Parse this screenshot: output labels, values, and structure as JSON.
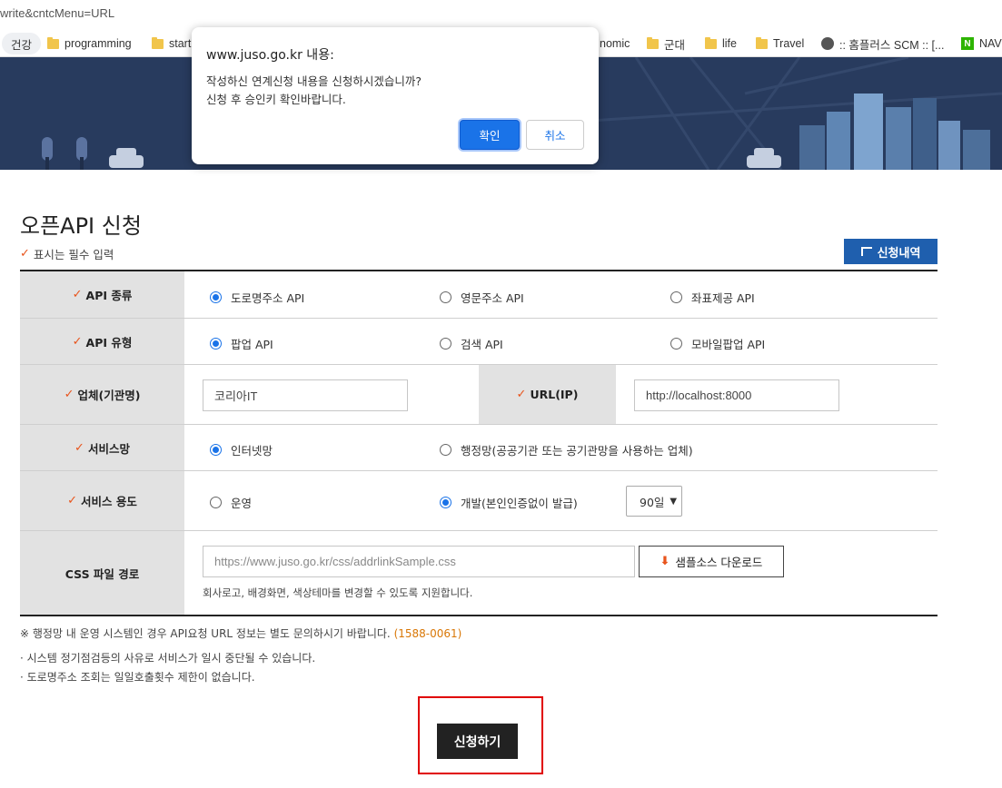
{
  "browser": {
    "url_fragment": "write&cntcMenu=URL",
    "bookmarks": [
      {
        "label": "건강",
        "icon": "tab-group"
      },
      {
        "label": "programming",
        "icon": "folder-icon"
      },
      {
        "label": "start",
        "icon": "folder-icon"
      },
      {
        "label": "nomic",
        "icon": "folder-icon"
      },
      {
        "label": "군대",
        "icon": "folder-icon"
      },
      {
        "label": "life",
        "icon": "folder-icon"
      },
      {
        "label": "Travel",
        "icon": "folder-icon"
      },
      {
        "label": ":: 홈플러스 SCM :: [...",
        "icon": "globe-icon"
      },
      {
        "label": "NAV",
        "icon": "naver-icon"
      }
    ]
  },
  "page": {
    "title": "오픈API 신청",
    "required_note": "표시는 필수 입력",
    "history_button": "신청내역"
  },
  "form": {
    "api_type": {
      "label": "API 종류",
      "options": [
        "도로명주소 API",
        "영문주소 API",
        "좌표제공 API"
      ],
      "selected": 0
    },
    "api_kind": {
      "label": "API 유형",
      "options": [
        "팝업 API",
        "검색 API",
        "모바일팝업 API"
      ],
      "selected": 0
    },
    "company": {
      "label": "업체(기관명)",
      "value": "코리아IT"
    },
    "url": {
      "label": "URL(IP)",
      "value": "http://localhost:8000"
    },
    "service_network": {
      "label": "서비스망",
      "options": [
        "인터넷망",
        "행정망(공공기관 또는 공기관망을 사용하는 업체)"
      ],
      "selected": 0
    },
    "service_usage": {
      "label": "서비스 용도",
      "options": [
        "운영",
        "개발(본인인증없이 발급)"
      ],
      "selected": 1,
      "period": "90일"
    },
    "css_path": {
      "label": "CSS 파일 경로",
      "placeholder": "https://www.juso.go.kr/css/addrlinkSample.css",
      "download_button": "샘플소스 다운로드",
      "helper": "회사로고, 배경화면, 색상테마를 변경할 수 있도록 지원합니다."
    }
  },
  "notes": {
    "admin_note": "※ 행정망 내 운영 시스템인 경우 API요청 URL 정보는 별도 문의하시기 바랍니다.",
    "phone": "(1588-0061)",
    "bullet1": "· 시스템 정기점검등의 사유로 서비스가 일시 중단될 수 있습니다.",
    "bullet2": "· 도로명주소 조회는 일일호출횟수 제한이 없습니다."
  },
  "submit_button": "신청하기",
  "dialog": {
    "title": "www.juso.go.kr 내용:",
    "line1": "작성하신 연계신청 내용을 신청하시겠습니까?",
    "line2": "신청 후 승인키 확인바랍니다.",
    "ok": "확인",
    "cancel": "취소"
  },
  "colors": {
    "accent_blue": "#1f5fae",
    "check_orange": "#e8541c",
    "banner": "#283b5e",
    "dialog_ok": "#1a73e8"
  }
}
